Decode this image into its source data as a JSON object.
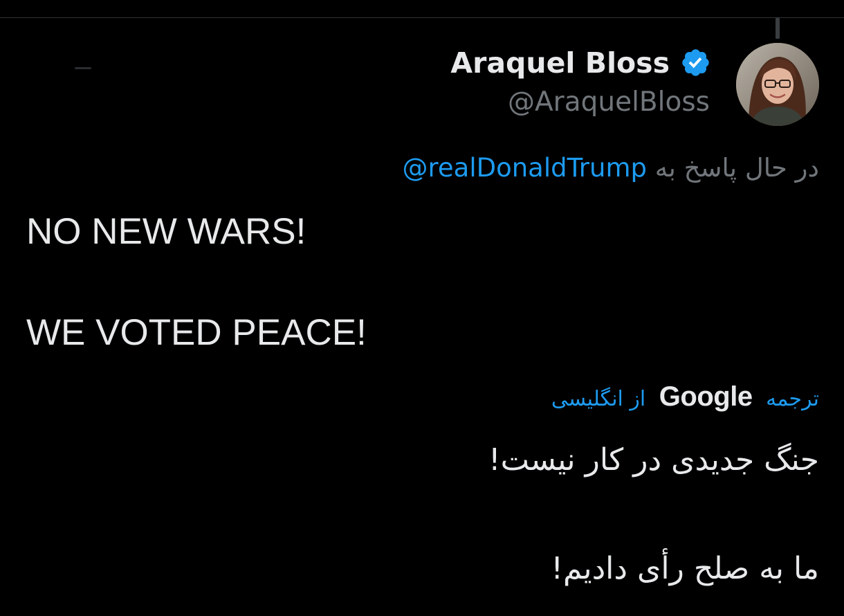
{
  "tweet": {
    "author": {
      "name": "Araquel Bloss",
      "handle": "@AraquelBloss",
      "verified": true,
      "avatar_icon": "profile-photo"
    },
    "reply": {
      "prefix": "در حال پاسخ به",
      "mention": "@realDonaldTrump"
    },
    "text_lines": [
      "NO NEW WARS!",
      "WE VOTED PEACE!"
    ],
    "translation": {
      "label_translate": "ترجمه",
      "provider": "Google",
      "label_from": "از انگلیسی",
      "lines": [
        "جنگ جدیدی در کار نیست!",
        "ما به صلح رأی دادیم!"
      ]
    }
  },
  "colors": {
    "background": "#000000",
    "text_primary": "#e7e9ea",
    "text_secondary": "#71767b",
    "accent": "#1d9bf0",
    "divider": "#2f3336"
  }
}
